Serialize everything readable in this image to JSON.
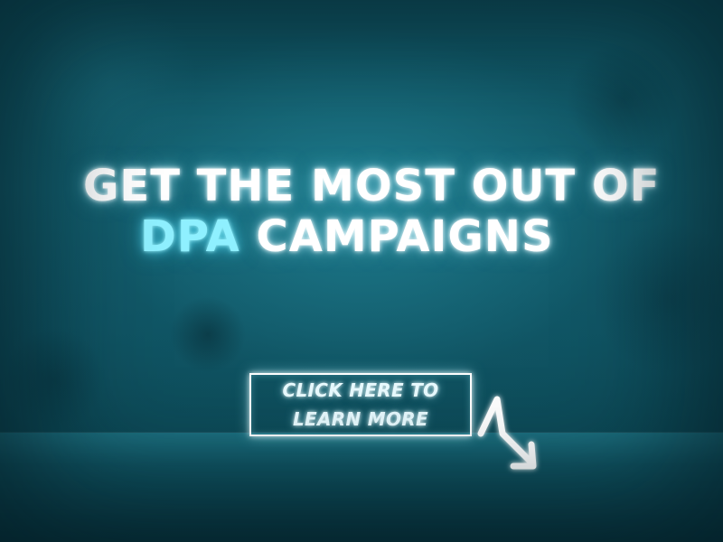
{
  "headline": {
    "line1": "GET THE MOST OUT OF",
    "line2_accent": "DPA",
    "line2_rest": " CAMPAIGNS"
  },
  "cta": {
    "line1": "CLICK HERE TO",
    "line2": "LEARN MORE"
  },
  "icons": {
    "pointer": "zigzag-arrow-icon"
  },
  "colors": {
    "background": "#135e6d",
    "headline_text": "#ffffff",
    "accent_text": "#8ff0ff",
    "cta_border": "#ffffff"
  }
}
